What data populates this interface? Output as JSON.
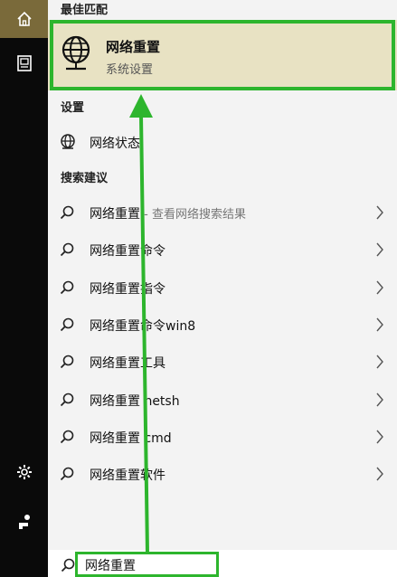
{
  "best_match": {
    "header": "最佳匹配",
    "title": "网络重置",
    "subtitle": "系统设置",
    "icon": "globe-icon"
  },
  "settings": {
    "header": "设置",
    "items": [
      {
        "label": "网络状态",
        "icon": "network-status-icon"
      }
    ]
  },
  "suggestions": {
    "header": "搜索建议",
    "items": [
      {
        "label": "网络重置",
        "hint": " - 查看网络搜索结果"
      },
      {
        "label": "网络重置命令",
        "hint": ""
      },
      {
        "label": "网络重置指令",
        "hint": ""
      },
      {
        "label": "网络重置命令win8",
        "hint": ""
      },
      {
        "label": "网络重置工具",
        "hint": ""
      },
      {
        "label": "网络重置 netsh",
        "hint": ""
      },
      {
        "label": "网络重置 cmd",
        "hint": ""
      },
      {
        "label": "网络重置软件",
        "hint": ""
      }
    ]
  },
  "search": {
    "value": "网络重置"
  },
  "rail": {
    "icons": [
      "home-icon",
      "document-icon",
      "gear-icon",
      "feedback-icon"
    ]
  },
  "colors": {
    "annotation": "#2db52d",
    "best_match_bg": "#e8e2c3",
    "rail_bg": "#0a0a0a",
    "rail_active": "#7a6a3a"
  }
}
